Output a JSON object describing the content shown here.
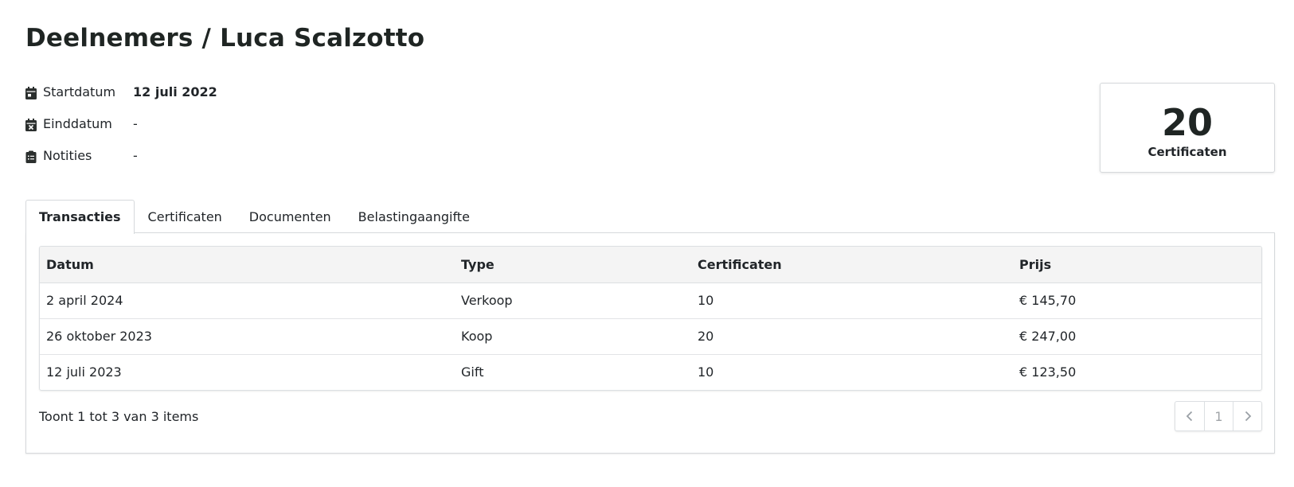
{
  "header": {
    "title": "Deelnemers / Luca Scalzotto"
  },
  "meta": [
    {
      "icon": "calendar-icon",
      "label": "Startdatum",
      "value": "12 juli 2022"
    },
    {
      "icon": "calendar-x-icon",
      "label": "Einddatum",
      "value": "-"
    },
    {
      "icon": "clipboard-icon",
      "label": "Notities",
      "value": "-"
    }
  ],
  "stat": {
    "value": "20",
    "label": "Certificaten"
  },
  "tabs": [
    {
      "label": "Transacties",
      "active": true
    },
    {
      "label": "Certificaten",
      "active": false
    },
    {
      "label": "Documenten",
      "active": false
    },
    {
      "label": "Belastingaangifte",
      "active": false
    }
  ],
  "table": {
    "headers": [
      "Datum",
      "Type",
      "Certificaten",
      "Prijs"
    ],
    "rows": [
      [
        "2 april 2024",
        "Verkoop",
        "10",
        "€ 145,70"
      ],
      [
        "26 oktober 2023",
        "Koop",
        "20",
        "€ 247,00"
      ],
      [
        "12 juli 2023",
        "Gift",
        "10",
        "€ 123,50"
      ]
    ]
  },
  "footer": {
    "summary": "Toont 1 tot 3 van 3 items"
  },
  "pagination": {
    "prev_icon": "chevron-left-icon",
    "current_page": "1",
    "next_icon": "chevron-right-icon"
  }
}
